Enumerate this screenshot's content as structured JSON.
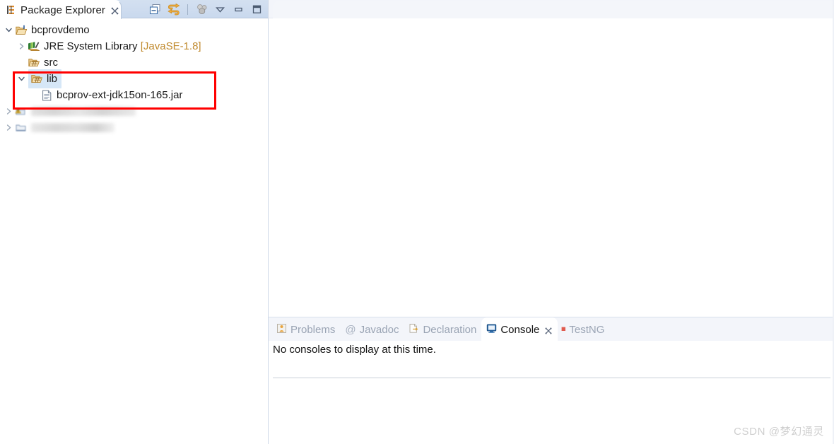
{
  "explorer": {
    "tab": {
      "label": "Package Explorer",
      "icon": "package-explorer-icon",
      "close_icon": "close-icon"
    },
    "toolbar": [
      {
        "name": "collapse-all-button",
        "icon": "collapse-all-icon",
        "tooltip": "Collapse All"
      },
      {
        "name": "link-with-editor-button",
        "icon": "link-with-editor-icon",
        "tooltip": "Link with Editor"
      },
      {
        "name": "focus-on-active-task-button",
        "icon": "focus-active-task-icon",
        "tooltip": "Focus on Active Task"
      },
      {
        "name": "view-menu-button",
        "icon": "chevron-down-icon",
        "tooltip": "View Menu"
      },
      {
        "name": "minimize-button",
        "icon": "minimize-icon",
        "tooltip": "Minimize"
      },
      {
        "name": "maximize-button",
        "icon": "maximize-icon",
        "tooltip": "Maximize"
      }
    ],
    "tree": [
      {
        "label": "bcprovdemo",
        "suffix": "",
        "icon": "java-project-icon",
        "twisty": "expanded",
        "indent": 0,
        "selected": false,
        "redacted": false
      },
      {
        "label": "JRE System Library",
        "suffix": "[JavaSE-1.8]",
        "icon": "jre-library-icon",
        "twisty": "collapsed",
        "indent": 1,
        "selected": false,
        "redacted": false
      },
      {
        "label": "src",
        "suffix": "",
        "icon": "source-folder-icon",
        "twisty": "none",
        "indent": 1,
        "selected": false,
        "redacted": false
      },
      {
        "label": "lib",
        "suffix": "",
        "icon": "source-folder-icon",
        "twisty": "expanded",
        "indent": 1,
        "selected": true,
        "redacted": false
      },
      {
        "label": "bcprov-ext-jdk15on-165.jar",
        "suffix": "",
        "icon": "jar-file-icon",
        "twisty": "none",
        "indent": 2,
        "selected": false,
        "redacted": false
      },
      {
        "label": "",
        "suffix": "",
        "icon": "warning-decorated-icon",
        "twisty": "collapsed",
        "indent": 0,
        "selected": false,
        "redacted": true,
        "redact_width": 148
      },
      {
        "label": "",
        "suffix": "",
        "icon": "project-icon",
        "twisty": "collapsed",
        "indent": 0,
        "selected": false,
        "redacted": true,
        "redact_width": 118
      }
    ],
    "highlight": {
      "name": "red-annotation-box",
      "color": "#ff0000",
      "covers": "lib folder and bcprov-ext-jdk15on-165.jar"
    }
  },
  "editor": {
    "name": "editor-area",
    "content": ""
  },
  "bottom_panel": {
    "tabs": [
      {
        "label": "Problems",
        "icon": "problems-icon",
        "active": false,
        "closable": false
      },
      {
        "label": "Javadoc",
        "icon": "javadoc-icon",
        "active": false,
        "closable": false
      },
      {
        "label": "Declaration",
        "icon": "declaration-icon",
        "active": false,
        "closable": false
      },
      {
        "label": "Console",
        "icon": "console-icon",
        "active": true,
        "closable": true
      },
      {
        "label": "TestNG",
        "icon": "testng-icon",
        "active": false,
        "closable": false
      }
    ],
    "console_message": "No consoles to display at this time."
  },
  "watermark": {
    "text": "CSDN @梦幻通灵"
  },
  "colors": {
    "tab_strip": "#cedcef",
    "selection": "#d6e7f7",
    "annotation_red": "#ff0000",
    "dim_text": "#c08a2e",
    "inactive_tab_text": "#9aa4b4"
  }
}
